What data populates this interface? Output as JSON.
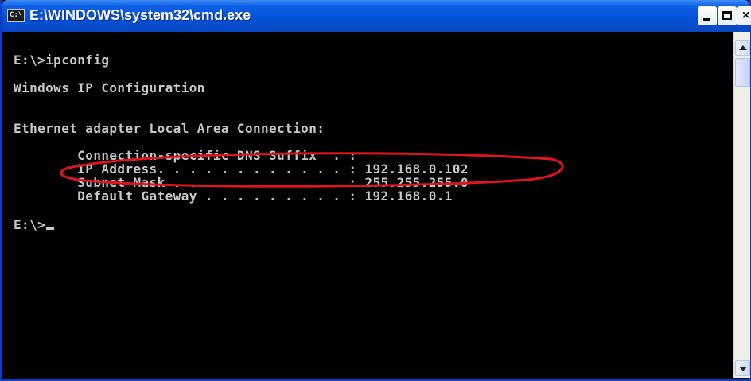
{
  "window": {
    "title": "E:\\WINDOWS\\system32\\cmd.exe",
    "icon": "cmd-icon",
    "icon_text": "C:\\",
    "buttons": {
      "minimize": "minimize-icon",
      "maximize": "maximize-icon",
      "close": "×"
    }
  },
  "console": {
    "lines": [
      "E:\\>ipconfig",
      "Windows IP Configuration",
      "Ethernet adapter Local Area Connection:",
      "        Connection-specific DNS Suffix  . :",
      "        IP Address. . . . . . . . . . . . : 192.168.0.102",
      "        Subnet Mask . . . . . . . . . . . : 255.255.255.0",
      "        Default Gateway . . . . . . . . . : 192.168.0.1",
      "E:\\>"
    ],
    "highlight_color": "#e0141e",
    "text_color": "#c8c8c8",
    "background": "#000000"
  },
  "scrollbar": {
    "up": "scroll-up-arrow-icon",
    "down": "scroll-down-arrow-icon"
  }
}
